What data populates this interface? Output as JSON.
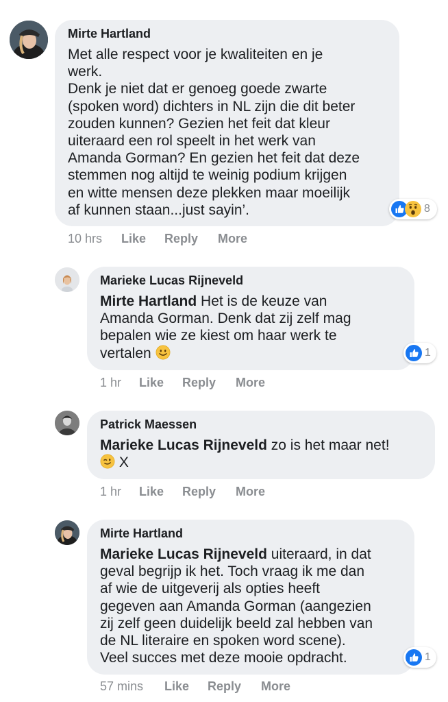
{
  "comments": [
    {
      "author": "Mirte Hartland",
      "mention": "",
      "lines": [
        "Met alle respect voor je kwaliteiten en je",
        "werk.",
        "Denk je niet dat er genoeg goede zwarte",
        "(spoken word) dichters in NL zijn die dit beter",
        "zouden kunnen? Gezien het feit dat kleur",
        "uiteraard een rol speelt in het werk van",
        "Amanda Gorman? En gezien het feit dat deze",
        "stemmen nog altijd te weinig podium krijgen",
        "en witte mensen deze plekken maar moeilijk",
        "af kunnen staan...just sayin’."
      ],
      "time": "10 hrs",
      "like": "Like",
      "reply": "Reply",
      "more": "More",
      "reaction_count": "8",
      "reactions": [
        "like-icon",
        "wow-icon"
      ]
    },
    {
      "author": "Marieke Lucas Rijneveld",
      "mention": "Mirte Hartland",
      "line1_rest": " Het is de keuze van",
      "lines": [
        "Amanda Gorman. Denk dat zij zelf mag",
        "bepalen wie ze kiest om haar werk te",
        "vertalen"
      ],
      "time": "1 hr",
      "like": "Like",
      "reply": "Reply",
      "more": "More",
      "reaction_count": "1",
      "reactions": [
        "like-icon"
      ],
      "emoji": "smile-emoji"
    },
    {
      "author": "Patrick Maessen",
      "mention": "Marieke Lucas Rijneveld",
      "line1_rest": " zo is het maar net!",
      "line2": "X",
      "time": "1 hr",
      "like": "Like",
      "reply": "Reply",
      "more": "More",
      "emoji": "wink-emoji"
    },
    {
      "author": "Mirte Hartland",
      "mention": "Marieke Lucas Rijneveld",
      "line1_rest": " uiteraard, in dat",
      "lines": [
        "geval begrijp ik het. Toch vraag ik me dan",
        "af wie de uitgeverij als opties heeft",
        "gegeven aan Amanda Gorman (aangezien",
        "zij zelf geen duidelijk beeld zal hebben van",
        "de NL literaire en spoken word scene).",
        "Veel succes met deze mooie opdracht."
      ],
      "time": "57 mins",
      "like": "Like",
      "reply": "Reply",
      "more": "More",
      "reaction_count": "1",
      "reactions": [
        "like-icon"
      ]
    }
  ],
  "colors": {
    "bubble": "#edeff2",
    "text": "#1c1e21",
    "meta": "#8a8d91",
    "like_blue": "#1877f2",
    "wow_yellow": "#f7c340"
  }
}
